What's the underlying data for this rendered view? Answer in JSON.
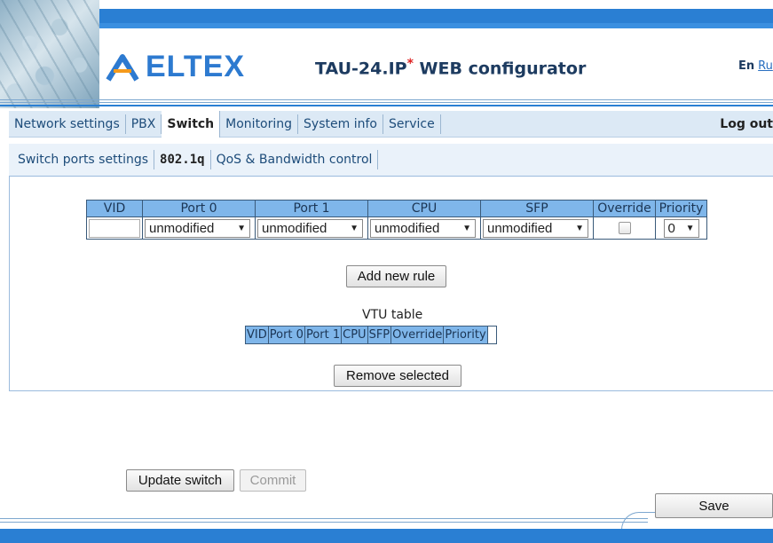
{
  "header": {
    "brand": "ELTEX",
    "product": "TAU-24.IP",
    "product_mark": "*",
    "product_suffix": "WEB configurator",
    "lang_current": "En",
    "lang_other": "Ru"
  },
  "main_nav": {
    "items": [
      {
        "label": "Network settings"
      },
      {
        "label": "PBX"
      },
      {
        "label": "Switch"
      },
      {
        "label": "Monitoring"
      },
      {
        "label": "System info"
      },
      {
        "label": "Service"
      }
    ],
    "active": "Switch",
    "logout": "Log out"
  },
  "sub_nav": {
    "items": [
      {
        "label": "Switch ports settings"
      },
      {
        "label": "802.1q"
      },
      {
        "label": "QoS & Bandwidth control"
      }
    ],
    "active": "802.1q"
  },
  "rule_table": {
    "headers": [
      "VID",
      "Port 0",
      "Port 1",
      "CPU",
      "SFP",
      "Override",
      "Priority"
    ],
    "row": {
      "vid": "",
      "port0": "unmodified",
      "port1": "unmodified",
      "cpu": "unmodified",
      "sfp": "unmodified",
      "override_checked": false,
      "priority": "0"
    }
  },
  "add_rule_button": "Add new rule",
  "vtu": {
    "title": "VTU table",
    "headers": [
      "VID",
      "Port 0",
      "Port 1",
      "CPU",
      "SFP",
      "Override",
      "Priority"
    ]
  },
  "remove_button": "Remove selected",
  "update_switch_button": "Update switch",
  "commit_button": "Commit",
  "save_button": "Save",
  "colors": {
    "brand_blue": "#2a7fd3",
    "table_header": "#7fb6ea",
    "nav_bg": "#dce9f5"
  }
}
